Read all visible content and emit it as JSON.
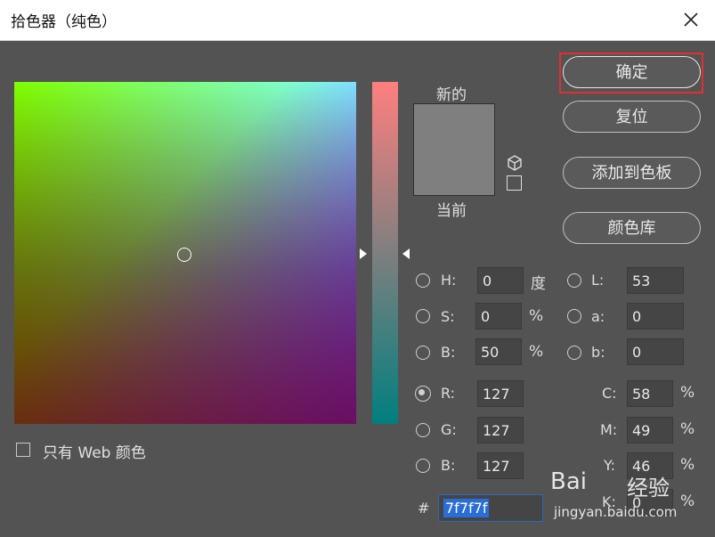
{
  "window": {
    "title": "拾色器（纯色）"
  },
  "preview": {
    "new_label": "新的",
    "current_label": "当前",
    "new_color": "#7f7f7f"
  },
  "buttons": {
    "ok": "确定",
    "reset": "复位",
    "add_swatch": "添加到色板",
    "libraries": "颜色库"
  },
  "hsb": {
    "h": {
      "label": "H:",
      "value": "0",
      "unit": "度"
    },
    "s": {
      "label": "S:",
      "value": "0",
      "unit": "%"
    },
    "b": {
      "label": "B:",
      "value": "50",
      "unit": "%"
    }
  },
  "lab": {
    "l": {
      "label": "L:",
      "value": "53"
    },
    "a": {
      "label": "a:",
      "value": "0"
    },
    "b": {
      "label": "b:",
      "value": "0"
    }
  },
  "rgb": {
    "r": {
      "label": "R:",
      "value": "127"
    },
    "g": {
      "label": "G:",
      "value": "127"
    },
    "b": {
      "label": "B:",
      "value": "127"
    }
  },
  "cmyk": {
    "c": {
      "label": "C:",
      "value": "58",
      "unit": "%"
    },
    "m": {
      "label": "M:",
      "value": "49",
      "unit": "%"
    },
    "y": {
      "label": "Y:",
      "value": "46",
      "unit": "%"
    },
    "k": {
      "label": "K:",
      "value": "0",
      "unit": "%"
    }
  },
  "hex": {
    "label": "#",
    "value": "7f7f7f"
  },
  "web_only": {
    "label": "只有 Web 颜色"
  },
  "watermark": {
    "brand": "Bai",
    "brand2": "经验",
    "url": "jingyan.baidu.com"
  },
  "colors": {
    "accent": "#2a6dd6",
    "highlight": "#e03030"
  }
}
